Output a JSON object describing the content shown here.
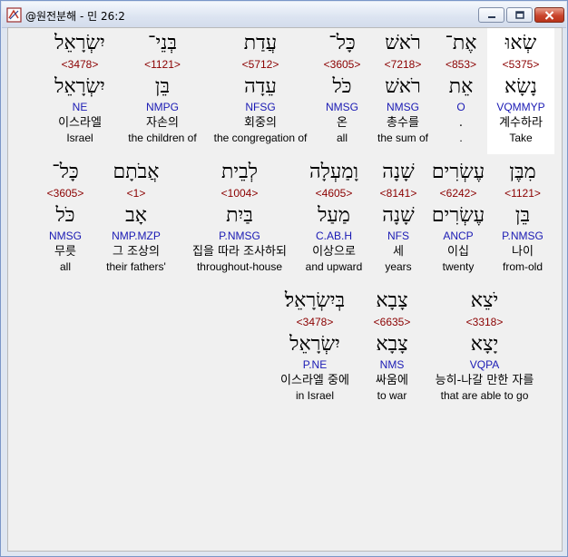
{
  "window": {
    "title": "@원전분해 - 민 26:2"
  },
  "rows": [
    [
      {
        "heb": "שְׂאוּ",
        "num": "<5375>",
        "root": "נָשָׂא",
        "parse": "VQMMYP",
        "kor": "계수하라",
        "eng": "Take",
        "highlight": true
      },
      {
        "heb": "אֶת־",
        "num": "<853>",
        "root": "אֵת",
        "parse": "O",
        "kor": ".",
        "eng": "."
      },
      {
        "heb": "רֹאשׁ",
        "num": "<7218>",
        "root": "רֹאשׁ",
        "parse": "NMSG",
        "kor": "총수를",
        "eng": "the sum of"
      },
      {
        "heb": "כָּל־",
        "num": "<3605>",
        "root": "כֹּל",
        "parse": "NMSG",
        "kor": "온",
        "eng": "all"
      },
      {
        "heb": "עֲדַת",
        "num": "<5712>",
        "root": "עֵדָה",
        "parse": "NFSG",
        "kor": "회중의",
        "eng": "the congregation of"
      },
      {
        "heb": "בְּנֵי־",
        "num": "<1121>",
        "root": "בֵּן",
        "parse": "NMPG",
        "kor": "자손의",
        "eng": "the children of"
      },
      {
        "heb": "יִשְׂרָאֵל",
        "num": "<3478>",
        "root": "יִשְׂרָאֵל",
        "parse": "NE",
        "kor": "이스라엘",
        "eng": "Israel"
      }
    ],
    [
      {
        "heb": "מִבֶּן",
        "num": "<1121>",
        "root": "בֵּן",
        "parse": "P.NMSG",
        "kor": "나이",
        "eng": "from-old"
      },
      {
        "heb": "עֶשְׂרִים",
        "num": "<6242>",
        "root": "עֶשְׂרִים",
        "parse": "ANCP",
        "kor": "이십",
        "eng": "twenty"
      },
      {
        "heb": "שָׁנָה",
        "num": "<8141>",
        "root": "שָׁנָה",
        "parse": "NFS",
        "kor": "세",
        "eng": "years"
      },
      {
        "heb": "וָמַעְלָה",
        "num": "<4605>",
        "root": "מַעַל",
        "parse": "C.AB.H",
        "kor": "이상으로",
        "eng": "and upward"
      },
      {
        "heb": "לְבֵית",
        "num": "<1004>",
        "root": "בַּיִת",
        "parse": "P.NMSG",
        "kor": "집을 따라 조사하되",
        "eng": "throughout-house"
      },
      {
        "heb": "אֲבֹתָם",
        "num": "<1>",
        "root": "אָב",
        "parse": "NMP.MZP",
        "kor": "그 조상의",
        "eng": "their fathers'"
      },
      {
        "heb": "כָּל־",
        "num": "<3605>",
        "root": "כֹּל",
        "parse": "NMSG",
        "kor": "무릇",
        "eng": "all"
      }
    ],
    [
      {
        "heb": "יֹצֵא",
        "num": "<3318>",
        "root": "יָצָא",
        "parse": "VQPA",
        "kor": "능히-나갈 만한 자를",
        "eng": "that are able to go"
      },
      {
        "heb": "צָבָא",
        "num": "<6635>",
        "root": "צָבָא",
        "parse": "NMS",
        "kor": "싸움에",
        "eng": "to war"
      },
      {
        "heb": "בְּיִשְׂרָאֵל׃",
        "num": "<3478>",
        "root": "יִשְׂרָאֵל",
        "parse": "P.NE",
        "kor": "이스라엘 중에",
        "eng": "in Israel"
      }
    ]
  ]
}
